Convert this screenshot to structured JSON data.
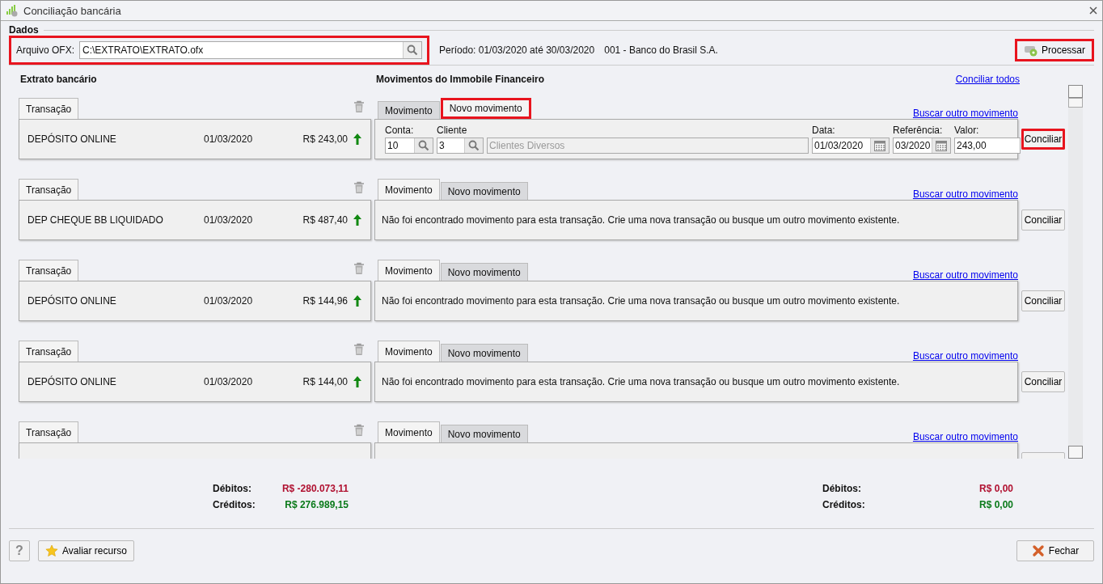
{
  "window": {
    "title": "Conciliação bancária"
  },
  "dados": {
    "title": "Dados",
    "file_label": "Arquivo OFX:",
    "file_value": "C:\\EXTRATO\\EXTRATO.ofx",
    "file_highlighted": true,
    "periodo": "Período: 01/03/2020 até 30/03/2020",
    "banco": "001 - Banco do Brasil S.A.",
    "process_button": {
      "label": "Processar",
      "highlighted": true
    }
  },
  "left_title": "Extrato bancário",
  "right_title": "Movimentos do Immobile Financeiro",
  "conciliar_todos": "Conciliar todos",
  "rows": [
    {
      "transaction_tab": "Transação",
      "description": "DEPÓSITO ONLINE",
      "date": "01/03/2020",
      "amount": "R$ 243,00",
      "tabs": [
        {
          "label": "Movimento",
          "selected": false,
          "highlighted": false
        },
        {
          "label": "Novo movimento",
          "selected": true,
          "highlighted": true
        }
      ],
      "link": "Buscar outro movimento",
      "panel": {
        "kind": "form",
        "conta_label": "Conta:",
        "conta": "10",
        "cliente_label": "Cliente",
        "cliente": "3",
        "cliente_nome": "Clientes Diversos",
        "data_label": "Data:",
        "data": "01/03/2020",
        "referencia_label": "Referência:",
        "referencia": "03/2020",
        "valor_label": "Valor:",
        "valor": "243,00"
      },
      "button": {
        "label": "Conciliar",
        "highlighted": true
      }
    },
    {
      "transaction_tab": "Transação",
      "description": "DEP CHEQUE BB LIQUIDADO",
      "date": "01/03/2020",
      "amount": "R$ 487,40",
      "tabs": [
        {
          "label": "Movimento",
          "selected": true,
          "highlighted": false
        },
        {
          "label": "Novo movimento",
          "selected": false,
          "highlighted": false
        }
      ],
      "link": "Buscar outro movimento",
      "panel": {
        "kind": "message",
        "text": "Não foi encontrado movimento para esta transação. Crie uma nova transação ou busque um outro movimento existente."
      },
      "button": {
        "label": "Conciliar",
        "highlighted": false
      }
    },
    {
      "transaction_tab": "Transação",
      "description": "DEPÓSITO ONLINE",
      "date": "01/03/2020",
      "amount": "R$ 144,96",
      "tabs": [
        {
          "label": "Movimento",
          "selected": true,
          "highlighted": false
        },
        {
          "label": "Novo movimento",
          "selected": false,
          "highlighted": false
        }
      ],
      "link": "Buscar outro movimento",
      "panel": {
        "kind": "message",
        "text": "Não foi encontrado movimento para esta transação. Crie uma nova transação ou busque um outro movimento existente."
      },
      "button": {
        "label": "Conciliar",
        "highlighted": false
      }
    },
    {
      "transaction_tab": "Transação",
      "description": "DEPÓSITO ONLINE",
      "date": "01/03/2020",
      "amount": "R$ 144,00",
      "tabs": [
        {
          "label": "Movimento",
          "selected": true,
          "highlighted": false
        },
        {
          "label": "Novo movimento",
          "selected": false,
          "highlighted": false
        }
      ],
      "link": "Buscar outro movimento",
      "panel": {
        "kind": "message",
        "text": "Não foi encontrado movimento para esta transação. Crie uma nova transação ou busque um outro movimento existente."
      },
      "button": {
        "label": "Conciliar",
        "highlighted": false
      }
    },
    {
      "transaction_tab": "Transação",
      "tabs": [
        {
          "label": "Movimento",
          "selected": true,
          "highlighted": false
        },
        {
          "label": "Novo movimento",
          "selected": false,
          "highlighted": false
        }
      ],
      "link": "Buscar outro movimento",
      "panel": {
        "kind": "empty"
      },
      "button": {
        "highlighted": false
      }
    }
  ],
  "totals_left": [
    {
      "label": "Débitos:",
      "value": "R$ -280.073,11",
      "kind": "debit"
    },
    {
      "label": "Créditos:",
      "value": "R$ 276.989,15",
      "kind": "credit"
    }
  ],
  "totals_right": [
    {
      "label": "Débitos:",
      "value": "R$ 0,00",
      "kind": "debit"
    },
    {
      "label": "Créditos:",
      "value": "R$ 0,00",
      "kind": "credit"
    }
  ],
  "footer": {
    "help": "?",
    "rate_button": "Avaliar recurso",
    "close_button": "Fechar"
  }
}
